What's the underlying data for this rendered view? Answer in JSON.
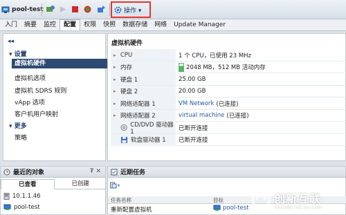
{
  "toolbar": {
    "vm_name": "pool-test",
    "operations_label": "操作 ▾"
  },
  "tabs": [
    {
      "label": "入门"
    },
    {
      "label": "摘要"
    },
    {
      "label": "监控"
    },
    {
      "label": "配置"
    },
    {
      "label": "权限"
    },
    {
      "label": "快照"
    },
    {
      "label": "数据存储"
    },
    {
      "label": "网络"
    },
    {
      "label": "Update Manager"
    }
  ],
  "nav": {
    "collapse": "◂◂",
    "settings_section": "▾ 设置",
    "settings_items": [
      {
        "label": "虚拟机硬件"
      },
      {
        "label": "虚拟机选项"
      },
      {
        "label": "虚拟机 SDRS 规则"
      },
      {
        "label": "vApp 选项"
      },
      {
        "label": "客户机用户映射"
      }
    ],
    "more_section": "▾ 更多",
    "more_items": [
      {
        "label": "策略"
      }
    ]
  },
  "main": {
    "title": "虚拟机硬件",
    "rows": [
      {
        "label": "CPU",
        "value": "1 个 CPU，已使用 23 MHz"
      },
      {
        "label": "内存",
        "value": "2048 MB，512 MB 活动内存"
      },
      {
        "label": "硬盘 1",
        "value": "25.00 GB"
      },
      {
        "label": "硬盘 2",
        "value": "20.00 GB"
      },
      {
        "label": "网络适配器 1",
        "value_link": "VM Network",
        "value_suffix": "(已连接)"
      },
      {
        "label": "网络适配器 2",
        "value_link": "virtual machine",
        "value_suffix": "(已连接)"
      },
      {
        "label": "CD/DVD 驱动器 1",
        "value": "已断开连接"
      },
      {
        "label": "软盘驱动器 1",
        "value": "已断开连接"
      }
    ]
  },
  "recent": {
    "title": "最近的对象",
    "pin": "₮ ✕",
    "tab_viewed": "已查看",
    "tab_created": "已创建",
    "items": [
      {
        "label": "10.1.1.46"
      },
      {
        "label": "pool-test"
      }
    ]
  },
  "tasks": {
    "title": "近期任务",
    "col_task": "任务名称",
    "col_target": "目标",
    "row_task": "重新配置虚拟机",
    "row_target": "pool-test"
  },
  "watermark": {
    "cn": "创新互联",
    "en": "CHUANG XIN HU LIAN"
  },
  "colors": {
    "highlight_box": "#e8332e",
    "nav_selected": "#2d4b72",
    "link": "#2659a8"
  }
}
